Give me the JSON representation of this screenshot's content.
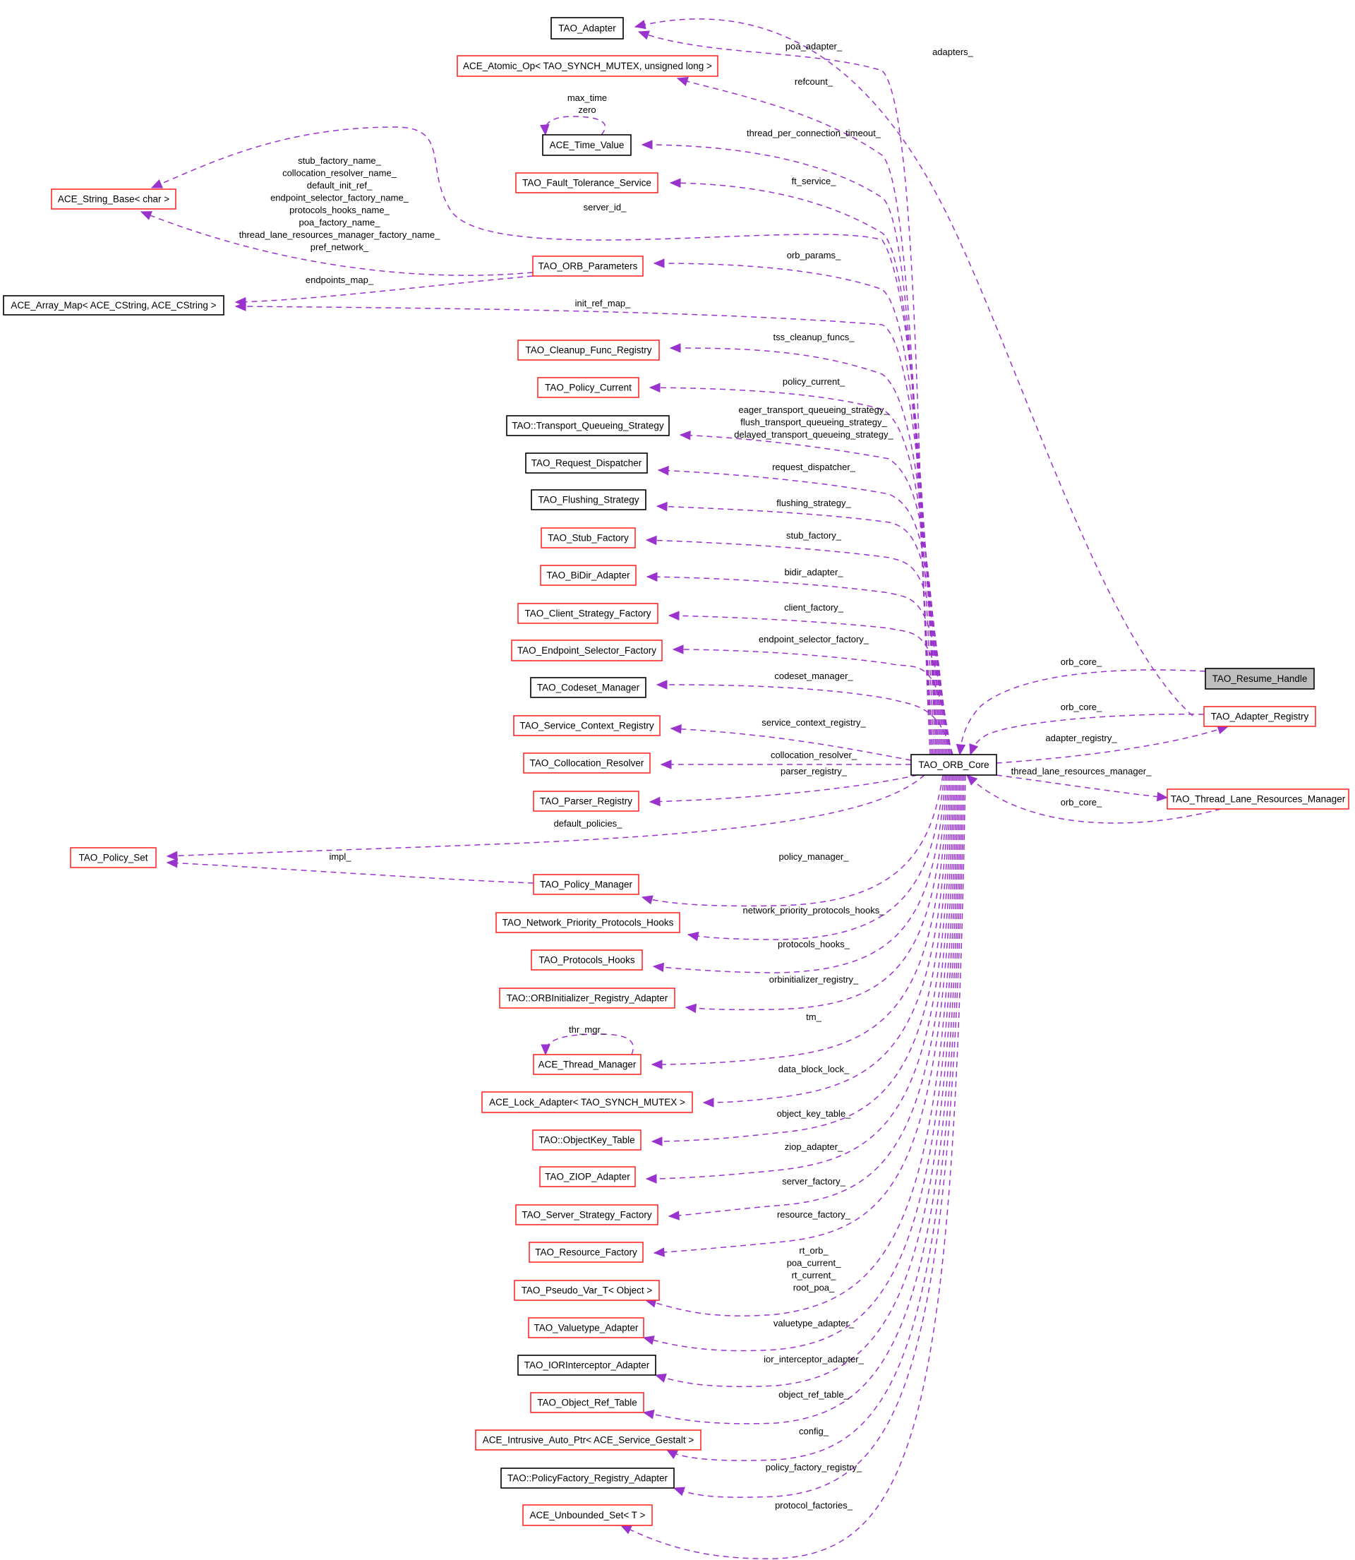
{
  "diagram": {
    "type": "collaboration-graph",
    "focus_node": "TAO_Resume_Handle",
    "colors": {
      "edge": "#9a32cd",
      "documented_border": "#ff0000",
      "undocumented_border": "#000000",
      "focus_fill": "#bfbfbf"
    },
    "nodes": [
      {
        "id": "tao_adapter",
        "label": "TAO_Adapter",
        "style": "black"
      },
      {
        "id": "ace_atomic_op",
        "label": "ACE_Atomic_Op< TAO_SYNCH_MUTEX, unsigned long >",
        "style": "red"
      },
      {
        "id": "ace_time_value",
        "label": "ACE_Time_Value",
        "style": "black"
      },
      {
        "id": "tao_fault_tolerance_service",
        "label": "TAO_Fault_Tolerance_Service",
        "style": "red"
      },
      {
        "id": "ace_string_base",
        "label": "ACE_String_Base< char >",
        "style": "red"
      },
      {
        "id": "tao_orb_parameters",
        "label": "TAO_ORB_Parameters",
        "style": "red"
      },
      {
        "id": "ace_array_map",
        "label": "ACE_Array_Map< ACE_CString, ACE_CString >",
        "style": "black"
      },
      {
        "id": "tao_cleanup_func_registry",
        "label": "TAO_Cleanup_Func_Registry",
        "style": "red"
      },
      {
        "id": "tao_policy_current",
        "label": "TAO_Policy_Current",
        "style": "red"
      },
      {
        "id": "tao_transport_queueing_strategy",
        "label": "TAO::Transport_Queueing_Strategy",
        "style": "black"
      },
      {
        "id": "tao_request_dispatcher",
        "label": "TAO_Request_Dispatcher",
        "style": "black"
      },
      {
        "id": "tao_flushing_strategy",
        "label": "TAO_Flushing_Strategy",
        "style": "black"
      },
      {
        "id": "tao_stub_factory",
        "label": "TAO_Stub_Factory",
        "style": "red"
      },
      {
        "id": "tao_bidir_adapter",
        "label": "TAO_BiDir_Adapter",
        "style": "red"
      },
      {
        "id": "tao_client_strategy_factory",
        "label": "TAO_Client_Strategy_Factory",
        "style": "red"
      },
      {
        "id": "tao_endpoint_selector_factory",
        "label": "TAO_Endpoint_Selector_Factory",
        "style": "red"
      },
      {
        "id": "tao_codeset_manager",
        "label": "TAO_Codeset_Manager",
        "style": "black"
      },
      {
        "id": "tao_service_context_registry",
        "label": "TAO_Service_Context_Registry",
        "style": "red"
      },
      {
        "id": "tao_collocation_resolver",
        "label": "TAO_Collocation_Resolver",
        "style": "red"
      },
      {
        "id": "tao_parser_registry",
        "label": "TAO_Parser_Registry",
        "style": "red"
      },
      {
        "id": "tao_policy_set",
        "label": "TAO_Policy_Set",
        "style": "red"
      },
      {
        "id": "tao_policy_manager",
        "label": "TAO_Policy_Manager",
        "style": "red"
      },
      {
        "id": "tao_network_priority_protocols_hooks",
        "label": "TAO_Network_Priority_Protocols_Hooks",
        "style": "red"
      },
      {
        "id": "tao_protocols_hooks",
        "label": "TAO_Protocols_Hooks",
        "style": "red"
      },
      {
        "id": "tao_orbinitializer_registry_adapter",
        "label": "TAO::ORBInitializer_Registry_Adapter",
        "style": "red"
      },
      {
        "id": "ace_thread_manager",
        "label": "ACE_Thread_Manager",
        "style": "red"
      },
      {
        "id": "ace_lock_adapter",
        "label": "ACE_Lock_Adapter< TAO_SYNCH_MUTEX >",
        "style": "red"
      },
      {
        "id": "tao_objectkey_table",
        "label": "TAO::ObjectKey_Table",
        "style": "red"
      },
      {
        "id": "tao_ziop_adapter",
        "label": "TAO_ZIOP_Adapter",
        "style": "red"
      },
      {
        "id": "tao_server_strategy_factory",
        "label": "TAO_Server_Strategy_Factory",
        "style": "red"
      },
      {
        "id": "tao_resource_factory",
        "label": "TAO_Resource_Factory",
        "style": "red"
      },
      {
        "id": "tao_pseudo_var_t",
        "label": "TAO_Pseudo_Var_T< Object >",
        "style": "red"
      },
      {
        "id": "tao_valuetype_adapter",
        "label": "TAO_Valuetype_Adapter",
        "style": "red"
      },
      {
        "id": "tao_iorinterceptor_adapter",
        "label": "TAO_IORInterceptor_Adapter",
        "style": "black"
      },
      {
        "id": "tao_object_ref_table",
        "label": "TAO_Object_Ref_Table",
        "style": "red"
      },
      {
        "id": "ace_intrusive_auto_ptr",
        "label": "ACE_Intrusive_Auto_Ptr< ACE_Service_Gestalt >",
        "style": "red"
      },
      {
        "id": "tao_policyfactory_registry_adapter",
        "label": "TAO::PolicyFactory_Registry_Adapter",
        "style": "black"
      },
      {
        "id": "ace_unbounded_set",
        "label": "ACE_Unbounded_Set< T >",
        "style": "red"
      },
      {
        "id": "tao_orb_core",
        "label": "TAO_ORB_Core",
        "style": "black"
      },
      {
        "id": "tao_resume_handle",
        "label": "TAO_Resume_Handle",
        "style": "gray"
      },
      {
        "id": "tao_adapter_registry",
        "label": "TAO_Adapter_Registry",
        "style": "red"
      },
      {
        "id": "tao_thread_lane_resources_manager",
        "label": "TAO_Thread_Lane_Resources_Manager",
        "style": "red"
      }
    ],
    "edges": [
      {
        "from": "tao_adapter_registry",
        "to": "tao_adapter",
        "label": [
          "adapters_"
        ]
      },
      {
        "from": "tao_orb_core",
        "to": "tao_adapter",
        "label": [
          "poa_adapter_"
        ]
      },
      {
        "from": "tao_orb_core",
        "to": "ace_atomic_op",
        "label": [
          "refcount_"
        ]
      },
      {
        "from": "ace_time_value",
        "to": "ace_time_value",
        "label": [
          "max_time",
          "zero"
        ]
      },
      {
        "from": "tao_orb_core",
        "to": "ace_time_value",
        "label": [
          "thread_per_connection_timeout_"
        ]
      },
      {
        "from": "tao_orb_core",
        "to": "tao_fault_tolerance_service",
        "label": [
          "ft_service_"
        ]
      },
      {
        "from": "tao_orb_core",
        "to": "ace_string_base",
        "label": [
          "server_id_"
        ]
      },
      {
        "from": "tao_orb_parameters",
        "to": "ace_string_base",
        "label": [
          "stub_factory_name_",
          "collocation_resolver_name_",
          "default_init_ref_",
          "endpoint_selector_factory_name_",
          "protocols_hooks_name_",
          "poa_factory_name_",
          "thread_lane_resources_manager_factory_name_",
          "pref_network_"
        ]
      },
      {
        "from": "tao_orb_parameters",
        "to": "ace_array_map",
        "label": [
          "endpoints_map_"
        ]
      },
      {
        "from": "tao_orb_core",
        "to": "tao_orb_parameters",
        "label": [
          "orb_params_"
        ]
      },
      {
        "from": "tao_orb_core",
        "to": "ace_array_map",
        "label": [
          "init_ref_map_"
        ]
      },
      {
        "from": "tao_orb_core",
        "to": "tao_cleanup_func_registry",
        "label": [
          "tss_cleanup_funcs_"
        ]
      },
      {
        "from": "tao_orb_core",
        "to": "tao_policy_current",
        "label": [
          "policy_current_"
        ]
      },
      {
        "from": "tao_orb_core",
        "to": "tao_transport_queueing_strategy",
        "label": [
          "eager_transport_queueing_strategy_",
          "flush_transport_queueing_strategy_",
          "delayed_transport_queueing_strategy_"
        ]
      },
      {
        "from": "tao_orb_core",
        "to": "tao_request_dispatcher",
        "label": [
          "request_dispatcher_"
        ]
      },
      {
        "from": "tao_orb_core",
        "to": "tao_flushing_strategy",
        "label": [
          "flushing_strategy_"
        ]
      },
      {
        "from": "tao_orb_core",
        "to": "tao_stub_factory",
        "label": [
          "stub_factory_"
        ]
      },
      {
        "from": "tao_orb_core",
        "to": "tao_bidir_adapter",
        "label": [
          "bidir_adapter_"
        ]
      },
      {
        "from": "tao_orb_core",
        "to": "tao_client_strategy_factory",
        "label": [
          "client_factory_"
        ]
      },
      {
        "from": "tao_orb_core",
        "to": "tao_endpoint_selector_factory",
        "label": [
          "endpoint_selector_factory_"
        ]
      },
      {
        "from": "tao_orb_core",
        "to": "tao_codeset_manager",
        "label": [
          "codeset_manager_"
        ]
      },
      {
        "from": "tao_orb_core",
        "to": "tao_service_context_registry",
        "label": [
          "service_context_registry_"
        ]
      },
      {
        "from": "tao_orb_core",
        "to": "tao_collocation_resolver",
        "label": [
          "collocation_resolver_"
        ]
      },
      {
        "from": "tao_orb_core",
        "to": "tao_parser_registry",
        "label": [
          "parser_registry_"
        ]
      },
      {
        "from": "tao_orb_core",
        "to": "tao_policy_set",
        "label": [
          "default_policies_"
        ]
      },
      {
        "from": "tao_policy_manager",
        "to": "tao_policy_set",
        "label": [
          "impl_"
        ]
      },
      {
        "from": "tao_orb_core",
        "to": "tao_policy_manager",
        "label": [
          "policy_manager_"
        ]
      },
      {
        "from": "tao_orb_core",
        "to": "tao_network_priority_protocols_hooks",
        "label": [
          "network_priority_protocols_hooks_"
        ]
      },
      {
        "from": "tao_orb_core",
        "to": "tao_protocols_hooks",
        "label": [
          "protocols_hooks_"
        ]
      },
      {
        "from": "tao_orb_core",
        "to": "tao_orbinitializer_registry_adapter",
        "label": [
          "orbinitializer_registry_"
        ]
      },
      {
        "from": "ace_thread_manager",
        "to": "ace_thread_manager",
        "label": [
          "thr_mgr_"
        ]
      },
      {
        "from": "tao_orb_core",
        "to": "ace_thread_manager",
        "label": [
          "tm_"
        ]
      },
      {
        "from": "tao_orb_core",
        "to": "ace_lock_adapter",
        "label": [
          "data_block_lock_"
        ]
      },
      {
        "from": "tao_orb_core",
        "to": "tao_objectkey_table",
        "label": [
          "object_key_table_"
        ]
      },
      {
        "from": "tao_orb_core",
        "to": "tao_ziop_adapter",
        "label": [
          "ziop_adapter_"
        ]
      },
      {
        "from": "tao_orb_core",
        "to": "tao_server_strategy_factory",
        "label": [
          "server_factory_"
        ]
      },
      {
        "from": "tao_orb_core",
        "to": "tao_resource_factory",
        "label": [
          "resource_factory_"
        ]
      },
      {
        "from": "tao_orb_core",
        "to": "tao_pseudo_var_t",
        "label": [
          "rt_orb_",
          "poa_current_",
          "rt_current_",
          "root_poa_"
        ]
      },
      {
        "from": "tao_orb_core",
        "to": "tao_valuetype_adapter",
        "label": [
          "valuetype_adapter_"
        ]
      },
      {
        "from": "tao_orb_core",
        "to": "tao_iorinterceptor_adapter",
        "label": [
          "ior_interceptor_adapter_"
        ]
      },
      {
        "from": "tao_orb_core",
        "to": "tao_object_ref_table",
        "label": [
          "object_ref_table_"
        ]
      },
      {
        "from": "tao_orb_core",
        "to": "ace_intrusive_auto_ptr",
        "label": [
          "config_"
        ]
      },
      {
        "from": "tao_orb_core",
        "to": "tao_policyfactory_registry_adapter",
        "label": [
          "policy_factory_registry_"
        ]
      },
      {
        "from": "tao_orb_core",
        "to": "ace_unbounded_set",
        "label": [
          "protocol_factories_"
        ]
      },
      {
        "from": "tao_resume_handle",
        "to": "tao_orb_core",
        "label": [
          "orb_core_"
        ]
      },
      {
        "from": "tao_adapter_registry",
        "to": "tao_orb_core",
        "label": [
          "orb_core_"
        ]
      },
      {
        "from": "tao_orb_core",
        "to": "tao_adapter_registry",
        "label": [
          "adapter_registry_"
        ]
      },
      {
        "from": "tao_orb_core",
        "to": "tao_thread_lane_resources_manager",
        "label": [
          "thread_lane_resources_manager_"
        ]
      },
      {
        "from": "tao_thread_lane_resources_manager",
        "to": "tao_orb_core",
        "label": [
          "orb_core_"
        ]
      }
    ]
  }
}
